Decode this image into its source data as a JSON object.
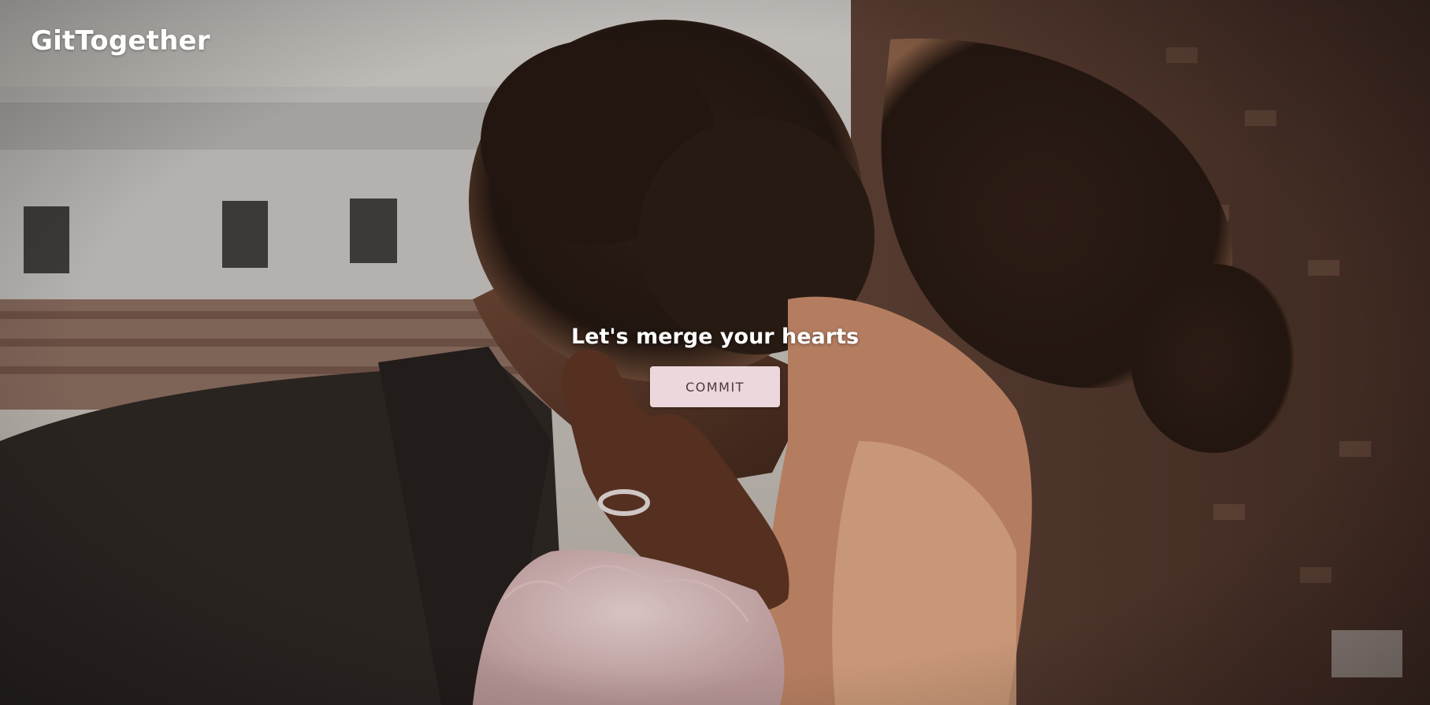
{
  "header": {
    "brand": "GitTogether"
  },
  "hero": {
    "tagline": "Let's merge your hearts",
    "button_label": "COMMIT"
  },
  "background": {
    "subject": "couple-embrace-photo"
  },
  "colors": {
    "button_bg": "#ecd7dc",
    "button_text": "#4a3a3e",
    "text": "#ffffff"
  }
}
